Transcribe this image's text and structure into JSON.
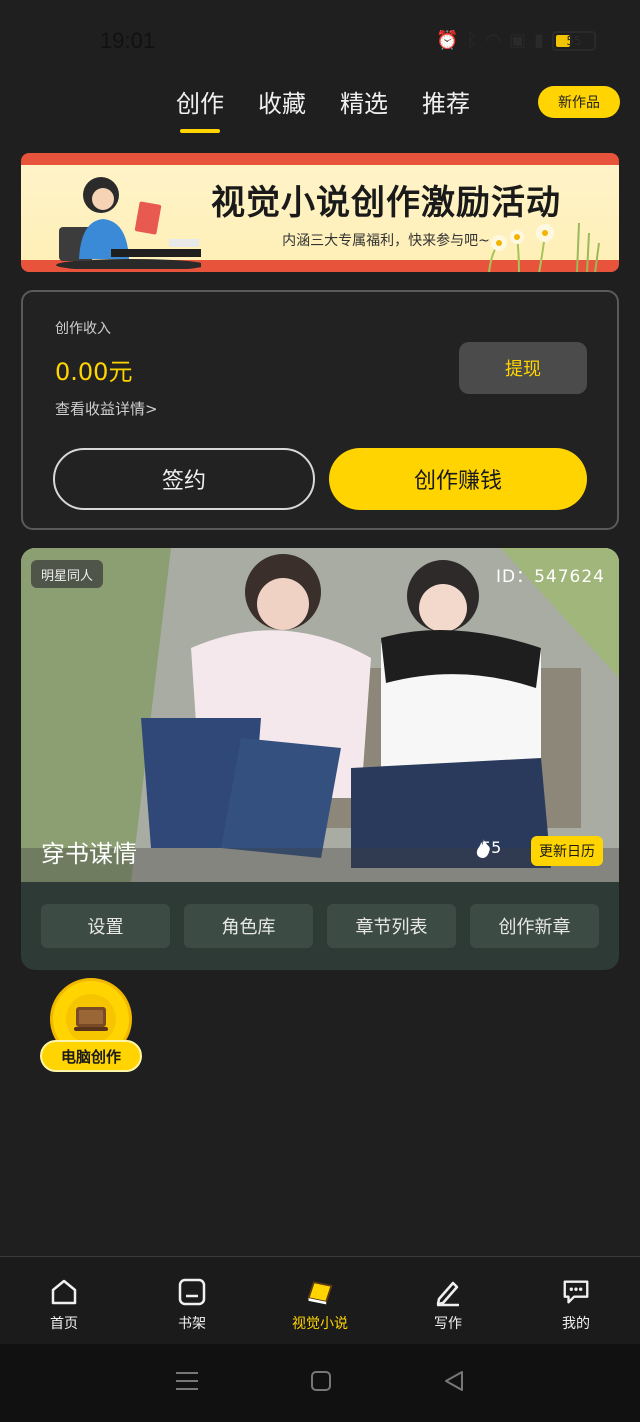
{
  "status": {
    "time": "19:01",
    "battery": "55"
  },
  "top_tabs": [
    {
      "label": "创作",
      "active": true
    },
    {
      "label": "收藏",
      "active": false
    },
    {
      "label": "精选",
      "active": false
    },
    {
      "label": "推荐",
      "active": false
    }
  ],
  "new_work_label": "新作品",
  "banner": {
    "title": "视觉小说创作激励活动",
    "subtitle": "内涵三大专属福利，快来参与吧~"
  },
  "income": {
    "label": "创作收入",
    "value": "0.00元",
    "detail_link": "查看收益详情>",
    "withdraw_label": "提现",
    "sign_label": "签约",
    "earn_label": "创作赚钱"
  },
  "work": {
    "tag": "明星同人",
    "id": "ID：547624",
    "title": "穿书谋情",
    "heat": "55",
    "update_label": "更新日历",
    "actions": [
      "设置",
      "角色库",
      "章节列表",
      "创作新章"
    ]
  },
  "pc_creation_label": "电脑创作",
  "bottom_nav": [
    {
      "label": "首页",
      "icon": "home-icon",
      "active": false
    },
    {
      "label": "书架",
      "icon": "bookshelf-icon",
      "active": false
    },
    {
      "label": "视觉小说",
      "icon": "visual-novel-icon",
      "active": true
    },
    {
      "label": "写作",
      "icon": "pencil-icon",
      "active": false
    },
    {
      "label": "我的",
      "icon": "chat-icon",
      "active": false
    }
  ],
  "colors": {
    "accent": "#ffd400",
    "background": "#1f1f1f",
    "card": "#2d3a35"
  }
}
